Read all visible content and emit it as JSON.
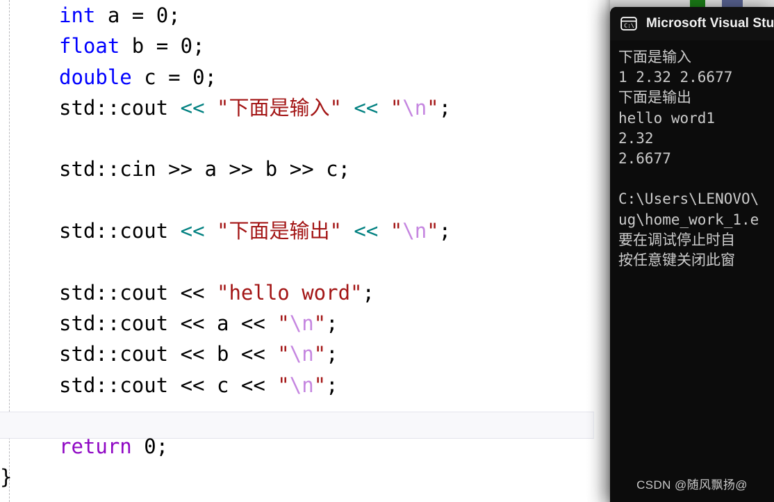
{
  "editor": {
    "indent_guide": true,
    "current_line_index": 13,
    "colors": {
      "background": "#ffffff",
      "keyword": "#0000ff",
      "return_keyword": "#8f08c4",
      "operator_overload": "#008080",
      "string": "#a31515",
      "escape": "#c586e0",
      "plain": "#000000",
      "indent_guide": "#b9b9bd",
      "current_line_fill": "#f8f8fb"
    },
    "code_lines": [
      {
        "tokens": [
          {
            "t": "int",
            "c": "kw"
          },
          {
            "t": " a = 0;",
            "c": "pln"
          }
        ]
      },
      {
        "tokens": [
          {
            "t": "float",
            "c": "kw"
          },
          {
            "t": " b = 0;",
            "c": "pln"
          }
        ]
      },
      {
        "tokens": [
          {
            "t": "double",
            "c": "kw"
          },
          {
            "t": " c = 0;",
            "c": "pln"
          }
        ]
      },
      {
        "tokens": [
          {
            "t": "std::cout ",
            "c": "pln"
          },
          {
            "t": "<<",
            "c": "op-ovl"
          },
          {
            "t": " ",
            "c": "pln"
          },
          {
            "t": "\"下面是输入\"",
            "c": "str"
          },
          {
            "t": " ",
            "c": "pln"
          },
          {
            "t": "<<",
            "c": "op-ovl"
          },
          {
            "t": " ",
            "c": "pln"
          },
          {
            "t": "\"",
            "c": "str"
          },
          {
            "t": "\\n",
            "c": "esc"
          },
          {
            "t": "\"",
            "c": "str"
          },
          {
            "t": ";",
            "c": "pln"
          }
        ]
      },
      {
        "tokens": []
      },
      {
        "tokens": [
          {
            "t": "std::cin >> a >> b >> c;",
            "c": "pln"
          }
        ]
      },
      {
        "tokens": []
      },
      {
        "tokens": [
          {
            "t": "std::cout ",
            "c": "pln"
          },
          {
            "t": "<<",
            "c": "op-ovl"
          },
          {
            "t": " ",
            "c": "pln"
          },
          {
            "t": "\"下面是输出\"",
            "c": "str"
          },
          {
            "t": " ",
            "c": "pln"
          },
          {
            "t": "<<",
            "c": "op-ovl"
          },
          {
            "t": " ",
            "c": "pln"
          },
          {
            "t": "\"",
            "c": "str"
          },
          {
            "t": "\\n",
            "c": "esc"
          },
          {
            "t": "\"",
            "c": "str"
          },
          {
            "t": ";",
            "c": "pln"
          }
        ]
      },
      {
        "tokens": []
      },
      {
        "tokens": [
          {
            "t": "std::cout << ",
            "c": "pln"
          },
          {
            "t": "\"hello word\"",
            "c": "str"
          },
          {
            "t": ";",
            "c": "pln"
          }
        ]
      },
      {
        "tokens": [
          {
            "t": "std::cout << a << ",
            "c": "pln"
          },
          {
            "t": "\"",
            "c": "str"
          },
          {
            "t": "\\n",
            "c": "esc"
          },
          {
            "t": "\"",
            "c": "str"
          },
          {
            "t": ";",
            "c": "pln"
          }
        ]
      },
      {
        "tokens": [
          {
            "t": "std::cout << b << ",
            "c": "pln"
          },
          {
            "t": "\"",
            "c": "str"
          },
          {
            "t": "\\n",
            "c": "esc"
          },
          {
            "t": "\"",
            "c": "str"
          },
          {
            "t": ";",
            "c": "pln"
          }
        ]
      },
      {
        "tokens": [
          {
            "t": "std::cout << c << ",
            "c": "pln"
          },
          {
            "t": "\"",
            "c": "str"
          },
          {
            "t": "\\n",
            "c": "esc"
          },
          {
            "t": "\"",
            "c": "str"
          },
          {
            "t": ";",
            "c": "pln"
          }
        ]
      },
      {
        "tokens": []
      },
      {
        "tokens": [
          {
            "t": "return",
            "c": "ret"
          },
          {
            "t": " 0;",
            "c": "pln"
          }
        ]
      },
      {
        "tokens": [
          {
            "t": "}",
            "c": "pln"
          }
        ],
        "no_indent": true
      }
    ]
  },
  "console": {
    "title": "Microsoft Visual Stu",
    "icon": "console-cmd-icon",
    "background": "#0c0c0c",
    "titlebar_background": "#111111",
    "text_color": "#cccccc",
    "output_lines": [
      "下面是输入",
      "1 2.32 2.6677",
      "下面是输出",
      "hello word1",
      "2.32",
      "2.6677",
      "",
      "C:\\Users\\LENOVO\\",
      "ug\\home_work_1.e",
      "要在调试停止时自",
      "按任意键关闭此窗"
    ],
    "watermark": "CSDN @随风飘扬@"
  },
  "desktop": {
    "tile_green_color": "#1a7a16",
    "tile_blue_color": "#555f8c"
  }
}
